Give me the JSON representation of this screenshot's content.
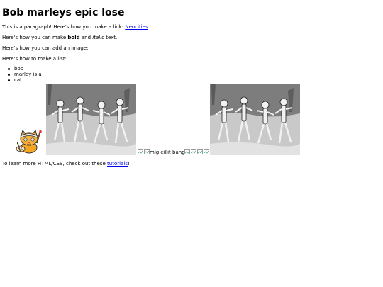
{
  "title": "Bob marleys epic lose",
  "para1": {
    "text": "This is a paragraph! Here's how you make a link: ",
    "link": "Neocities",
    "end": "."
  },
  "para2": {
    "start": "Here's how you can make ",
    "bold": "bold",
    "middle": " and ",
    "italic": "italic",
    "end": " text."
  },
  "para3": "Here's how you can add an image:",
  "para4": "Here's how to make a list:",
  "list": [
    "bob",
    "marley is a",
    "cat"
  ],
  "images": {
    "cat_alt": "",
    "broken_alt_text": "mlg cillit bang"
  },
  "footer": {
    "start": "To learn more HTML/CSS, check out these ",
    "link": "tutorials",
    "end": "!"
  },
  "colors": {
    "link": "#0000ee",
    "text": "#000000",
    "background": "#ffffff"
  }
}
